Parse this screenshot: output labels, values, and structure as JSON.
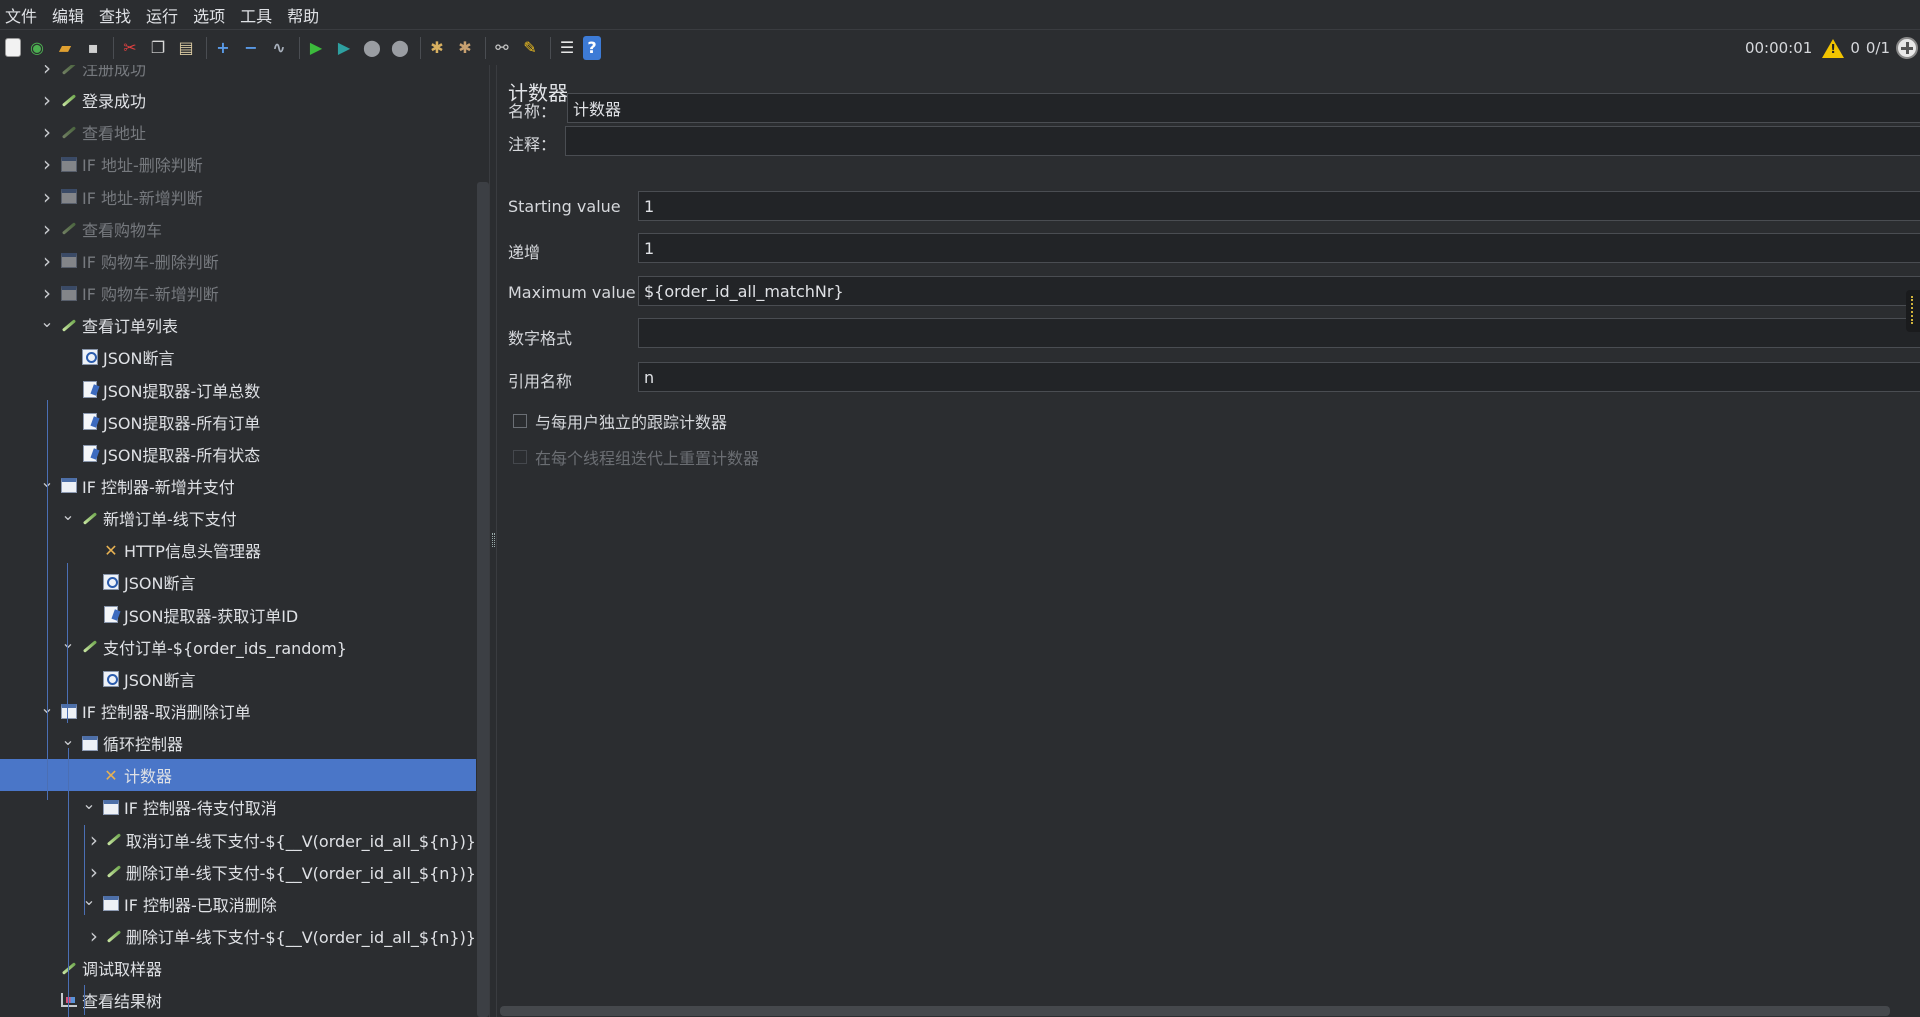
{
  "menubar": [
    "文件",
    "编辑",
    "查找",
    "运行",
    "选项",
    "工具",
    "帮助"
  ],
  "toolbar": {
    "buttons": [
      {
        "name": "new-icon",
        "glyph": "▯",
        "color": "#f2f2f2"
      },
      {
        "name": "templates-icon",
        "glyph": "◉",
        "color": "#4caf50"
      },
      {
        "name": "open-icon",
        "glyph": "▰",
        "color": "#e0a030"
      },
      {
        "name": "save-icon",
        "glyph": "▪",
        "color": "#d0d0d0"
      },
      {
        "name": "sep",
        "glyph": "",
        "color": ""
      },
      {
        "name": "cut-icon",
        "glyph": "✂",
        "color": "#e04040"
      },
      {
        "name": "copy-icon",
        "glyph": "❐",
        "color": "#d8d8d8"
      },
      {
        "name": "paste-icon",
        "glyph": "▤",
        "color": "#d8c8a0"
      },
      {
        "name": "sep",
        "glyph": "",
        "color": ""
      },
      {
        "name": "expand-icon",
        "glyph": "+",
        "color": "#5a9be8"
      },
      {
        "name": "collapse-icon",
        "glyph": "−",
        "color": "#5a9be8"
      },
      {
        "name": "toggle-icon",
        "glyph": "∿",
        "color": "#a8b0bc"
      },
      {
        "name": "sep",
        "glyph": "",
        "color": ""
      },
      {
        "name": "start-icon",
        "glyph": "▶",
        "color": "#3cba3c"
      },
      {
        "name": "start-no-pauses-icon",
        "glyph": "▶",
        "color": "#2ea0a0"
      },
      {
        "name": "stop-icon",
        "glyph": "⬤",
        "color": "#9a9da2"
      },
      {
        "name": "shutdown-icon",
        "glyph": "⬤",
        "color": "#9a9da2"
      },
      {
        "name": "sep",
        "glyph": "",
        "color": ""
      },
      {
        "name": "clear-icon",
        "glyph": "✱",
        "color": "#d8b060"
      },
      {
        "name": "clear-all-icon",
        "glyph": "✱",
        "color": "#c8a070"
      },
      {
        "name": "sep",
        "glyph": "",
        "color": ""
      },
      {
        "name": "search-icon",
        "glyph": "⚯",
        "color": "#c8c8c8"
      },
      {
        "name": "reset-search-icon",
        "glyph": "✎",
        "color": "#f0c020"
      },
      {
        "name": "sep",
        "glyph": "",
        "color": ""
      },
      {
        "name": "function-helper-icon",
        "glyph": "☰",
        "color": "#e8e8e8"
      },
      {
        "name": "help-icon",
        "glyph": "?",
        "color": "#ffffff"
      }
    ],
    "timer": "00:00:01",
    "warning_count": "0",
    "threads": "0/1"
  },
  "tree": [
    {
      "level": 1,
      "arrow": "right",
      "icon": "pen",
      "label": "注册成功",
      "disabled": true
    },
    {
      "level": 1,
      "arrow": "right",
      "icon": "pen",
      "label": "登录成功",
      "disabled": false
    },
    {
      "level": 1,
      "arrow": "right",
      "icon": "pen",
      "label": "查看地址",
      "disabled": true
    },
    {
      "level": 1,
      "arrow": "right",
      "icon": "box",
      "label": "IF 地址-删除判断",
      "disabled": true
    },
    {
      "level": 1,
      "arrow": "right",
      "icon": "box",
      "label": "IF 地址-新增判断",
      "disabled": true
    },
    {
      "level": 1,
      "arrow": "right",
      "icon": "pen",
      "label": "查看购物车",
      "disabled": true
    },
    {
      "level": 1,
      "arrow": "right",
      "icon": "box",
      "label": "IF 购物车-删除判断",
      "disabled": true
    },
    {
      "level": 1,
      "arrow": "right",
      "icon": "box",
      "label": "IF 购物车-新增判断",
      "disabled": true
    },
    {
      "level": 1,
      "arrow": "down",
      "icon": "pen",
      "label": "查看订单列表",
      "disabled": false
    },
    {
      "level": 2,
      "arrow": "none",
      "icon": "mag",
      "label": "JSON断言",
      "disabled": false
    },
    {
      "level": 2,
      "arrow": "none",
      "icon": "doc",
      "label": "JSON提取器-订单总数",
      "disabled": false
    },
    {
      "level": 2,
      "arrow": "none",
      "icon": "doc",
      "label": "JSON提取器-所有订单",
      "disabled": false
    },
    {
      "level": 2,
      "arrow": "none",
      "icon": "doc",
      "label": "JSON提取器-所有状态",
      "disabled": false
    },
    {
      "level": 1,
      "arrow": "down",
      "icon": "box",
      "label": "IF 控制器-新增并支付",
      "disabled": false
    },
    {
      "level": 2,
      "arrow": "down",
      "icon": "pen",
      "label": "新增订单-线下支付",
      "disabled": false
    },
    {
      "level": 3,
      "arrow": "none",
      "icon": "tool",
      "label": "HTTP信息头管理器",
      "disabled": false
    },
    {
      "level": 3,
      "arrow": "none",
      "icon": "mag",
      "label": "JSON断言",
      "disabled": false
    },
    {
      "level": 3,
      "arrow": "none",
      "icon": "doc",
      "label": "JSON提取器-获取订单ID",
      "disabled": false
    },
    {
      "level": 2,
      "arrow": "down",
      "icon": "pen",
      "label": "支付订单-${order_ids_random}",
      "disabled": false
    },
    {
      "level": 3,
      "arrow": "none",
      "icon": "mag",
      "label": "JSON断言",
      "disabled": false
    },
    {
      "level": 1,
      "arrow": "down",
      "icon": "box",
      "label": "IF 控制器-取消删除订单",
      "disabled": false
    },
    {
      "level": 2,
      "arrow": "down",
      "icon": "box",
      "label": "循环控制器",
      "disabled": false
    },
    {
      "level": 3,
      "arrow": "none",
      "icon": "tool",
      "label": "计数器",
      "disabled": false,
      "selected": true
    },
    {
      "level": 3,
      "arrow": "down",
      "icon": "box",
      "label": "IF 控制器-待支付取消",
      "disabled": false
    },
    {
      "level": 4,
      "arrow": "right",
      "icon": "pen",
      "label": "取消订单-线下支付-${__V(order_id_all_${n})}",
      "disabled": false
    },
    {
      "level": 4,
      "arrow": "right",
      "icon": "pen",
      "label": "删除订单-线下支付-${__V(order_id_all_${n})}",
      "disabled": false
    },
    {
      "level": 3,
      "arrow": "down",
      "icon": "box",
      "label": "IF 控制器-已取消删除",
      "disabled": false
    },
    {
      "level": 4,
      "arrow": "right",
      "icon": "pen",
      "label": "删除订单-线下支付-${__V(order_id_all_${n})}",
      "disabled": false
    },
    {
      "level": 1,
      "arrow": "none",
      "icon": "pen",
      "label": "调试取样器",
      "disabled": false
    },
    {
      "level": 1,
      "arrow": "none",
      "icon": "chart",
      "label": "查看结果树",
      "disabled": false
    }
  ],
  "panel": {
    "title": "计数器",
    "name_label": "名称：",
    "name_value": "计数器",
    "comment_label": "注释：",
    "comment_value": "",
    "start_label": "Starting value",
    "start_value": "1",
    "increment_label": "递增",
    "increment_value": "1",
    "max_label": "Maximum value",
    "max_value": "${order_id_all_matchNr}",
    "format_label": "数字格式",
    "format_value": "",
    "refname_label": "引用名称",
    "refname_value": "n",
    "per_user_label": "与每用户独立的跟踪计数器",
    "per_user_checked": false,
    "reset_label": "在每个线程组迭代上重置计数器",
    "reset_checked": false
  }
}
